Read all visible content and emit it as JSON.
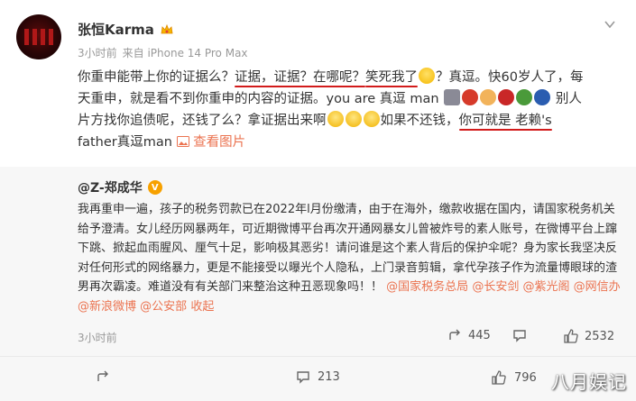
{
  "post": {
    "author": "张恒Karma",
    "time": "3小时前",
    "source": "来自 iPhone 14 Pro Max",
    "text": {
      "l1_a": "你重申能带上你的证据么？",
      "l1_u1": "证据，证据？在哪呢？",
      "l1_u2": "笑死我了",
      "l1_b": "？真逗。快60岁人了，每",
      "l2": "天重申，就是看不到你重申的内容的证据。you are 真逗 man",
      "l2_b": "别人",
      "l3_a": "片方找你追债呢，还钱了么？拿证据出来啊",
      "l3_b": "如果不还钱，",
      "l3_u": "你可就是 老赖's",
      "l4_a": "father真逗man",
      "l4_link": "查看图片"
    }
  },
  "repost": {
    "author": "@Z-郑成华",
    "text": "我再重申一遍，孩子的税务罚款已在2022年l月份缴清，由于在海外，缴款收据在国内，请国家税务机关给予澄清。女儿经历网暴两年，可近期微博平台再次开通网暴女儿曾被炸号的素人账号，在微博平台上蹿下跳、掀起血雨腥风、厘气十足，影响极其恶劣！请问谁是这个素人背后的保护伞呢？身为家长我坚决反对任何形式的网络暴力，更是不能接受以曝光个人隐私，上门录音剪辑，拿代孕孩子作为流量博眼球的渣男再次霸凌。难道没有有关部门来整治这种丑恶现象吗！！",
    "mentions": [
      "@国家税务总局",
      "@长安剑",
      "@紫光阁",
      "@网信办",
      "@新浪微博",
      "@公安部"
    ],
    "collapse": "收起",
    "time": "3小时前",
    "reposts": "445",
    "likes": "2532"
  },
  "bottom": {
    "reposts": "213",
    "likes": "796"
  },
  "watermark": "八月娱记",
  "colors": {
    "link": "#eb7350",
    "underline": "#d21b1b",
    "repost_bg": "#f7f7f7"
  }
}
